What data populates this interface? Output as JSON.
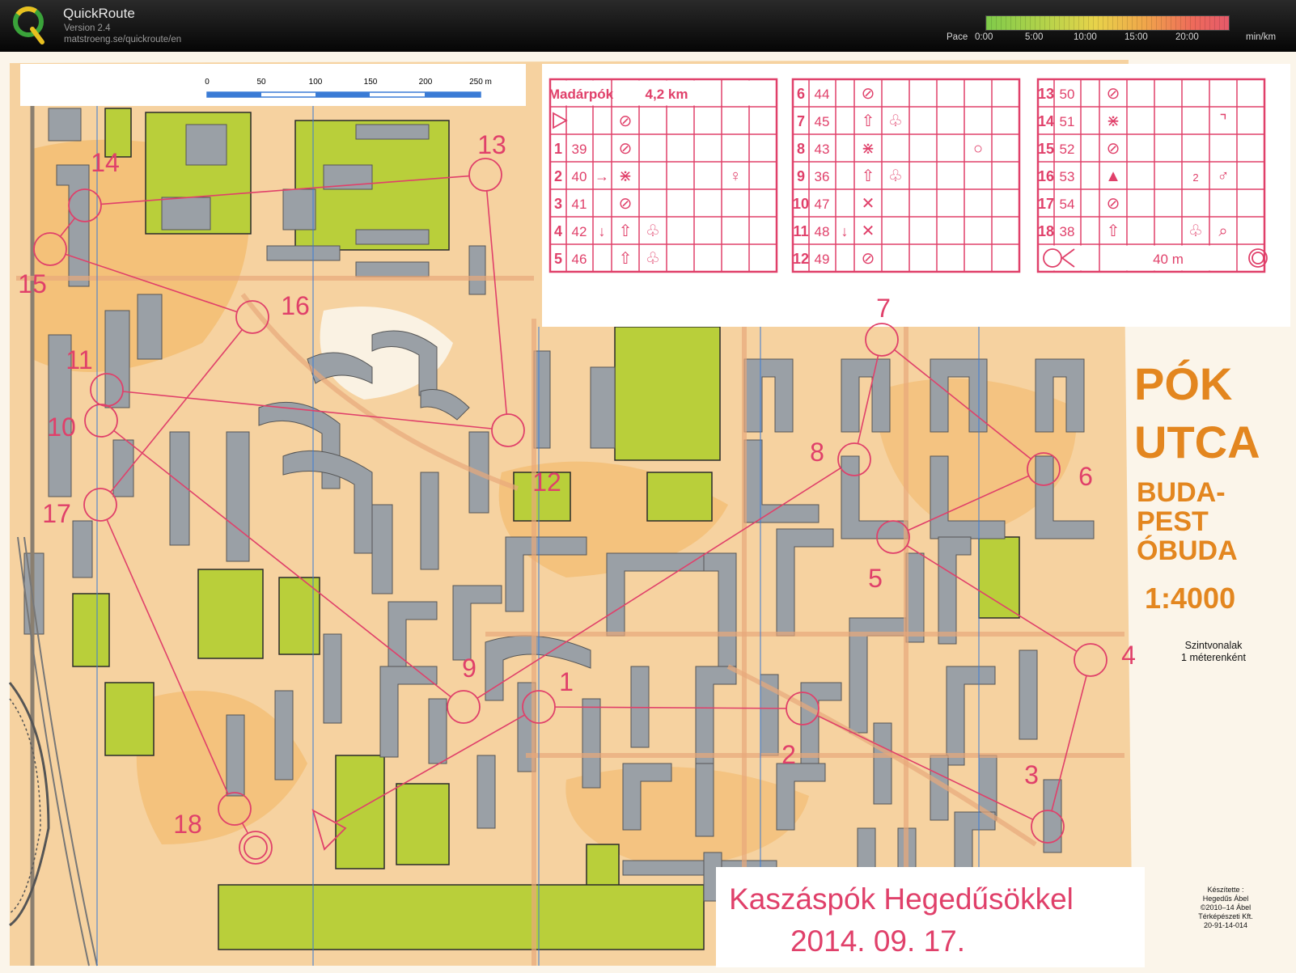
{
  "app": {
    "name": "QuickRoute",
    "version": "Version 2.4",
    "url": "matstroeng.se/quickroute/en"
  },
  "pace_scale": {
    "label": "Pace",
    "ticks": [
      "0:00",
      "5:00",
      "10:00",
      "15:00",
      "20:00"
    ],
    "unit": "min/km",
    "colors": [
      "#7fcb4a",
      "#e8d34a",
      "#f0a74a",
      "#e55a6a"
    ]
  },
  "map": {
    "title_lines": [
      "PÓK",
      "UTCA"
    ],
    "location_lines": [
      "BUDA-",
      "PEST",
      "ÓBUDA"
    ],
    "scale": "1:4000",
    "contour_note_lines": [
      "Szintvonalak",
      "1 méterenként"
    ],
    "event_line1": "Kaszáspók Hegedűsökkel",
    "event_line2": "2014. 09. 17.",
    "credits": [
      "Készítette :",
      "Hegedűs Ábel",
      "©2010–14  Ábel",
      "Térképészeti Kft.",
      "20-91-14-014"
    ],
    "scale_bar": {
      "ticks": [
        "0",
        "50",
        "100",
        "150",
        "200",
        "250 m"
      ]
    },
    "accent_color": "#e0406a"
  },
  "course": {
    "name": "Madárpók",
    "length": "4,2 km",
    "finish_distance": "40 m",
    "controls": [
      {
        "num": "1",
        "code": "39",
        "dir": "",
        "symbols": [
          "⊘"
        ]
      },
      {
        "num": "2",
        "code": "40",
        "dir": "→",
        "symbols": [
          "⋇",
          "",
          "♀"
        ]
      },
      {
        "num": "3",
        "code": "41",
        "dir": "",
        "symbols": [
          "⊘"
        ]
      },
      {
        "num": "4",
        "code": "42",
        "dir": "↓",
        "symbols": [
          "⇧",
          "♧"
        ]
      },
      {
        "num": "5",
        "code": "46",
        "dir": "",
        "symbols": [
          "⇧",
          "♧"
        ]
      },
      {
        "num": "6",
        "code": "44",
        "dir": "",
        "symbols": [
          "⊘"
        ]
      },
      {
        "num": "7",
        "code": "45",
        "dir": "",
        "symbols": [
          "⇧",
          "♧"
        ]
      },
      {
        "num": "8",
        "code": "43",
        "dir": "",
        "symbols": [
          "⋇",
          "",
          "○"
        ]
      },
      {
        "num": "9",
        "code": "36",
        "dir": "",
        "symbols": [
          "⇧",
          "♧"
        ]
      },
      {
        "num": "10",
        "code": "47",
        "dir": "",
        "symbols": [
          "✕"
        ]
      },
      {
        "num": "11",
        "code": "48",
        "dir": "↓",
        "symbols": [
          "✕"
        ]
      },
      {
        "num": "12",
        "code": "49",
        "dir": "",
        "symbols": [
          "⊘"
        ]
      },
      {
        "num": "13",
        "code": "50",
        "dir": "",
        "symbols": [
          "⊘"
        ]
      },
      {
        "num": "14",
        "code": "51",
        "dir": "",
        "symbols": [
          "⋇",
          "",
          "⌝"
        ]
      },
      {
        "num": "15",
        "code": "52",
        "dir": "",
        "symbols": [
          "⊘"
        ]
      },
      {
        "num": "16",
        "code": "53",
        "dir": "",
        "symbols": [
          "▲",
          "2",
          "♂"
        ]
      },
      {
        "num": "17",
        "code": "54",
        "dir": "",
        "symbols": [
          "⊘"
        ]
      },
      {
        "num": "18",
        "code": "38",
        "dir": "",
        "symbols": [
          "⇧",
          "♧",
          "⌕"
        ]
      }
    ]
  }
}
